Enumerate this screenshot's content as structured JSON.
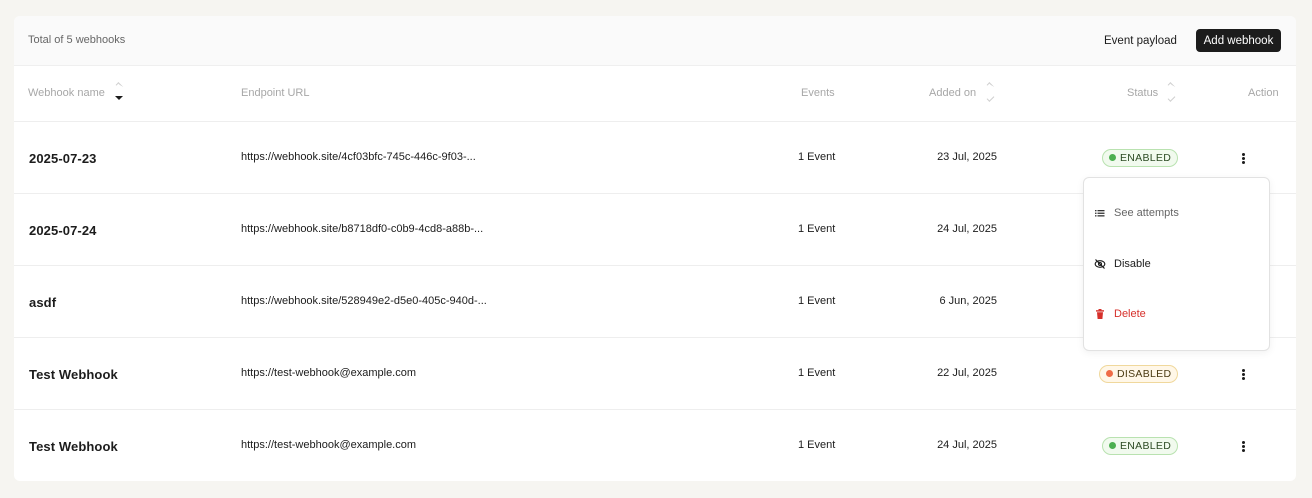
{
  "header": {
    "total_label": "Total of 5 webhooks",
    "event_payload_label": "Event payload",
    "add_webhook_label": "Add webhook"
  },
  "columns": {
    "name": "Webhook name",
    "url": "Endpoint URL",
    "events": "Events",
    "added": "Added on",
    "status": "Status",
    "action": "Action"
  },
  "rows": [
    {
      "name": "2025-07-23",
      "url": "https://webhook.site/4cf03bfc-745c-446c-9f03-...",
      "events": "1 Event",
      "added": "23 Jul, 2025",
      "status": "ENABLED"
    },
    {
      "name": "2025-07-24",
      "url": "https://webhook.site/b8718df0-c0b9-4cd8-a88b-...",
      "events": "1 Event",
      "added": "24 Jul, 2025",
      "status": ""
    },
    {
      "name": "asdf",
      "url": "https://webhook.site/528949e2-d5e0-405c-940d-...",
      "events": "1 Event",
      "added": "6 Jun, 2025",
      "status": ""
    },
    {
      "name": "Test Webhook",
      "url": "https://test-webhook@example.com",
      "events": "1 Event",
      "added": "22 Jul, 2025",
      "status": "DISABLED"
    },
    {
      "name": "Test Webhook",
      "url": "https://test-webhook@example.com",
      "events": "1 Event",
      "added": "24 Jul, 2025",
      "status": "ENABLED"
    }
  ],
  "menu": {
    "see_attempts": "See attempts",
    "disable": "Disable",
    "delete": "Delete"
  },
  "icons": {
    "list": "list-icon",
    "disable": "eye-off-icon",
    "delete": "trash-icon",
    "kebab": "kebab-icon"
  },
  "colors": {
    "primary_button": "#1c1c1c",
    "enabled_dot": "#4caf50",
    "disabled_dot": "#ef6c47",
    "danger": "#d6302b"
  }
}
